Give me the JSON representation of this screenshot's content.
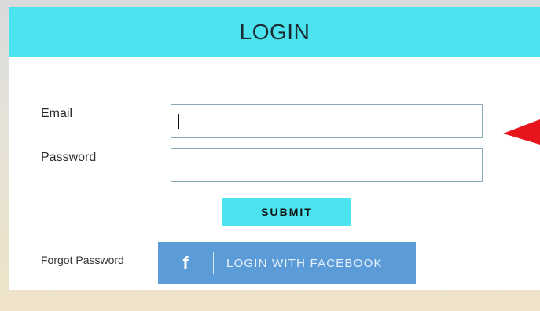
{
  "header": {
    "title": "LOGIN"
  },
  "form": {
    "email_label": "Email",
    "email_value": "",
    "password_label": "Password",
    "password_value": "",
    "submit_label": "SUBMIT"
  },
  "links": {
    "forgot_password": "Forgot Password"
  },
  "facebook": {
    "icon_glyph": "f",
    "label": "LOGIN WITH FACEBOOK"
  },
  "icons": {
    "facebook": "facebook-icon",
    "annotation_arrow": "red-arrow-icon"
  },
  "colors": {
    "accent": "#4ae3ee",
    "facebook": "#5b9bd8",
    "arrow": "#e8141b"
  }
}
